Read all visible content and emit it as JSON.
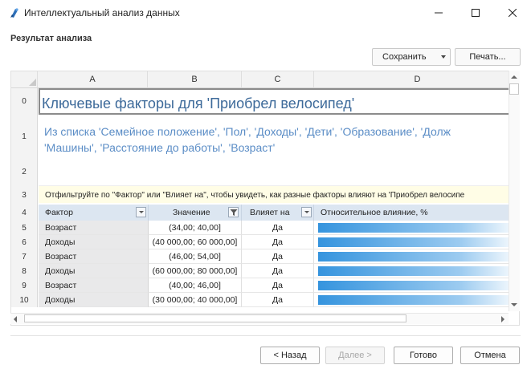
{
  "window": {
    "title": "Интеллектуальный анализ данных",
    "minimize": "—",
    "maximize": "□",
    "close": "✕"
  },
  "section_label": "Результат анализа",
  "toolbar": {
    "save_label": "Сохранить",
    "print_label": "Печать..."
  },
  "columns": [
    "A",
    "B",
    "C",
    "D"
  ],
  "row_numbers": [
    "0",
    "1",
    "2",
    "3",
    "4",
    "5",
    "6",
    "7",
    "8",
    "9",
    "10"
  ],
  "sheet": {
    "title": "Ключевые факторы для 'Приобрел велосипед'",
    "desc_line1": "Из списка 'Семейное положение', 'Пол', 'Доходы', 'Дети', 'Образование', 'Долж",
    "desc_line2": "'Машины', 'Расстояние до работы', 'Возраст'",
    "filter_note": "Отфильтруйте по \"Фактор\" или \"Влияет на\", чтобы увидеть, как разные факторы влияют на 'Приобрел велосипе"
  },
  "table": {
    "headers": [
      "Фактор",
      "Значение",
      "Влияет на",
      "Относительное влияние, %"
    ],
    "rows": [
      {
        "factor": "Возраст",
        "value": "(34,00; 40,00]",
        "influence": "Да",
        "relative": 100
      },
      {
        "factor": "Доходы",
        "value": "(40 000,00; 60 000,00]",
        "influence": "Да",
        "relative": 100
      },
      {
        "factor": "Возраст",
        "value": "(46,00; 54,00]",
        "influence": "Да",
        "relative": 100
      },
      {
        "factor": "Доходы",
        "value": "(60 000,00; 80 000,00]",
        "influence": "Да",
        "relative": 100
      },
      {
        "factor": "Возраст",
        "value": "(40,00; 46,00]",
        "influence": "Да",
        "relative": 100
      },
      {
        "factor": "Доходы",
        "value": "(30 000,00; 40 000,00]",
        "influence": "Да",
        "relative": 100
      }
    ]
  },
  "footer": {
    "back": "< Назад",
    "next": "Далее >",
    "done": "Готово",
    "cancel": "Отмена"
  }
}
